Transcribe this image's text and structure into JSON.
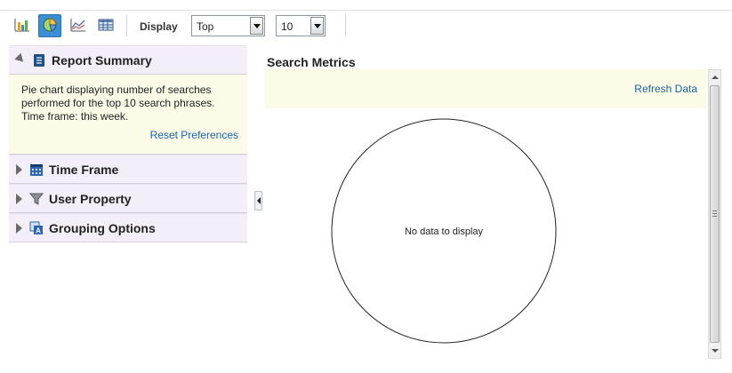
{
  "toolbar": {
    "buttons": [
      {
        "icon": "bar-chart-icon",
        "active": false
      },
      {
        "icon": "pie-chart-icon",
        "active": true
      },
      {
        "icon": "line-chart-icon",
        "active": false
      },
      {
        "icon": "table-icon",
        "active": false
      }
    ],
    "display_label": "Display",
    "display_select_value": "Top",
    "count_select_value": "10"
  },
  "left_panel": {
    "report_summary": {
      "title": "Report Summary",
      "icon": "document-icon",
      "expanded": true,
      "description": "Pie chart displaying number of searches performed for the top 10 search phrases. Time frame: this week.",
      "reset_link": "Reset Preferences"
    },
    "sections": [
      {
        "title": "Time Frame",
        "icon": "calendar-icon",
        "expanded": false
      },
      {
        "title": "User Property",
        "icon": "filter-icon",
        "expanded": false
      },
      {
        "title": "Grouping Options",
        "icon": "grouping-icon",
        "expanded": false
      }
    ]
  },
  "main": {
    "title": "Search Metrics",
    "refresh_link": "Refresh Data",
    "empty_message": "No data to display"
  },
  "colors": {
    "accent_blue": "#3b8fd6",
    "link": "#1a63a7",
    "panel_header": "#f3eef7",
    "info_background": "#fbfbe8"
  }
}
